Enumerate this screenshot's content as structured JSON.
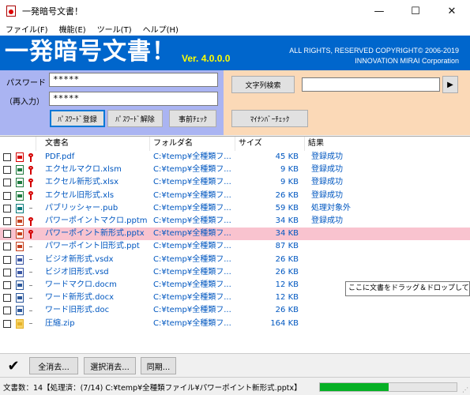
{
  "window": {
    "title": "一発暗号文書！",
    "min": "—",
    "max": "☐",
    "close": "✕"
  },
  "menu": [
    "ファイル(F)",
    "機能(E)",
    "ツール(T)",
    "ヘルプ(H)"
  ],
  "banner": {
    "title": "一発暗号文書！",
    "version": "Ver.  4.0.0.0",
    "copyright_line1": "ALL RIGHTS, RESERVED COPYRIGHT© 2006-2019",
    "copyright_line2": "INNOVATION MIRAI Corporation",
    "bg_color": "#0066cc"
  },
  "password": {
    "label": "パスワード",
    "value": "*****",
    "confirm_label": "（再入力）",
    "confirm_value": "*****",
    "register_button": "ﾊﾟｽﾜｰﾄﾞ登録",
    "release_button": "ﾊﾟｽﾜｰﾄﾞ解除",
    "precheck_button": "事前ﾁｪｯｸ"
  },
  "search": {
    "button": "文字列検索",
    "value": "",
    "go_button": "▶",
    "mynumber_button": "ﾏｲﾅﾝﾊﾞｰﾁｪｯｸ"
  },
  "table": {
    "headers": {
      "name": "文書名",
      "folder": "フォルダ名",
      "size": "サイズ",
      "result": "結果"
    },
    "rows": [
      {
        "name": "PDF.pdf",
        "folder": "C:¥temp¥全種類フ...",
        "size": "45 KB",
        "result": "登録成功",
        "icon": "pdf-file-icon",
        "locked": true,
        "selected": false
      },
      {
        "name": "エクセルマクロ.xlsm",
        "folder": "C:¥temp¥全種類フ...",
        "size": "9 KB",
        "result": "登録成功",
        "icon": "excel-file-icon",
        "locked": true,
        "selected": false
      },
      {
        "name": "エクセル新形式.xlsx",
        "folder": "C:¥temp¥全種類フ...",
        "size": "9 KB",
        "result": "登録成功",
        "icon": "excel-file-icon",
        "locked": true,
        "selected": false
      },
      {
        "name": "エクセル旧形式.xls",
        "folder": "C:¥temp¥全種類フ...",
        "size": "26 KB",
        "result": "登録成功",
        "icon": "excel-file-icon",
        "locked": true,
        "selected": false
      },
      {
        "name": "パブリッシャー.pub",
        "folder": "C:¥temp¥全種類フ...",
        "size": "59 KB",
        "result": "処理対象外",
        "icon": "publisher-file-icon",
        "locked": false,
        "selected": false
      },
      {
        "name": "パワーポイントマクロ.pptm",
        "folder": "C:¥temp¥全種類フ...",
        "size": "34 KB",
        "result": "登録成功",
        "icon": "powerpoint-file-icon",
        "locked": true,
        "selected": false
      },
      {
        "name": "パワーポイント新形式.pptx",
        "folder": "C:¥temp¥全種類フ...",
        "size": "34 KB",
        "result": "",
        "icon": "powerpoint-file-icon",
        "locked": true,
        "selected": true
      },
      {
        "name": "パワーポイント旧形式.ppt",
        "folder": "C:¥temp¥全種類フ...",
        "size": "87 KB",
        "result": "",
        "icon": "powerpoint-file-icon",
        "locked": false,
        "selected": false
      },
      {
        "name": "ビジオ新形式.vsdx",
        "folder": "C:¥temp¥全種類フ...",
        "size": "26 KB",
        "result": "",
        "icon": "visio-file-icon",
        "locked": false,
        "selected": false
      },
      {
        "name": "ビジオ旧形式.vsd",
        "folder": "C:¥temp¥全種類フ...",
        "size": "26 KB",
        "result": "",
        "icon": "visio-file-icon",
        "locked": false,
        "selected": false
      },
      {
        "name": "ワードマクロ.docm",
        "folder": "C:¥temp¥全種類フ...",
        "size": "12 KB",
        "result": "",
        "icon": "word-file-icon",
        "locked": false,
        "selected": false
      },
      {
        "name": "ワード新形式.docx",
        "folder": "C:¥temp¥全種類フ...",
        "size": "12 KB",
        "result": "",
        "icon": "word-file-icon",
        "locked": false,
        "selected": false
      },
      {
        "name": "ワード旧形式.doc",
        "folder": "C:¥temp¥全種類フ...",
        "size": "26 KB",
        "result": "",
        "icon": "word-file-icon",
        "locked": false,
        "selected": false
      },
      {
        "name": "圧縮.zip",
        "folder": "C:¥temp¥全種類フ...",
        "size": "164 KB",
        "result": "",
        "icon": "zip-folder-icon",
        "locked": false,
        "selected": false
      }
    ]
  },
  "tooltip": "ここに文書をドラッグ＆ドロップしてください",
  "actions": {
    "check_all": "✔",
    "clear_all": "全消去...",
    "clear_selected": "選択消去...",
    "sync": "同期..."
  },
  "status": {
    "text": "文書数：14【処理済：(7/14) C:¥temp¥全種類ファイル¥パワーポイント新形式.pptx】",
    "progress": 0.5
  }
}
